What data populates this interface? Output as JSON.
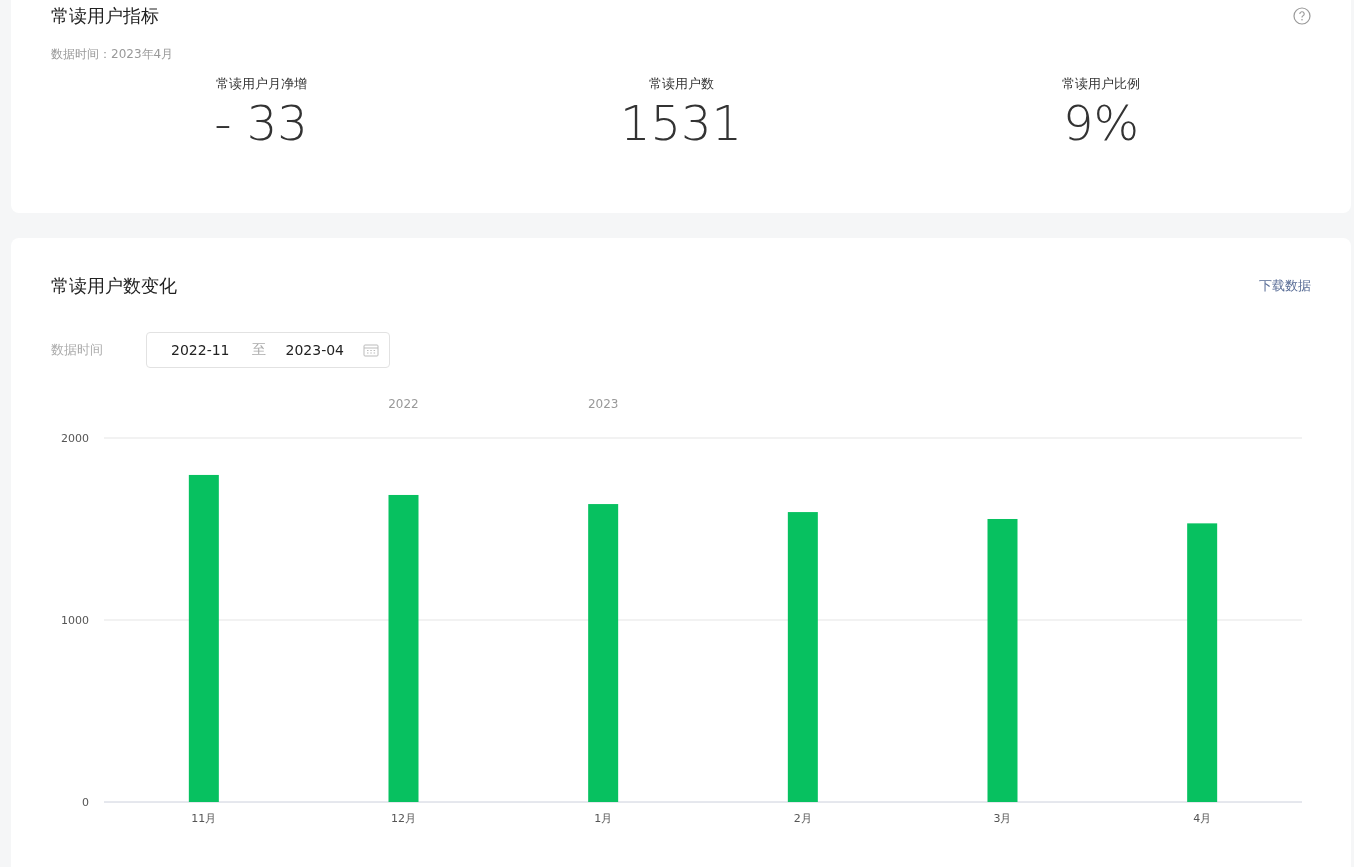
{
  "metrics_card": {
    "title": "常读用户指标",
    "data_time": "数据时间：2023年4月",
    "metrics": [
      {
        "label": "常读用户月净增",
        "value": "- 33"
      },
      {
        "label": "常读用户数",
        "value": "1531"
      },
      {
        "label": "常读用户比例",
        "value": "9%"
      }
    ]
  },
  "trend_card": {
    "title": "常读用户数变化",
    "download_link": "下载数据",
    "date_label": "数据时间",
    "date_start": "2022-11",
    "date_separator": "至",
    "date_end": "2023-04",
    "chart_data": {
      "type": "bar",
      "categories": [
        "11月",
        "12月",
        "1月",
        "2月",
        "3月",
        "4月"
      ],
      "series": [
        {
          "color": "#07c160",
          "values": [
            1797,
            1687,
            1637,
            1593,
            1555,
            1531
          ]
        }
      ],
      "ylim": [
        0,
        2000
      ],
      "yticks": [
        0,
        1000,
        2000
      ],
      "annotations": [
        "2022",
        "2023"
      ]
    }
  }
}
